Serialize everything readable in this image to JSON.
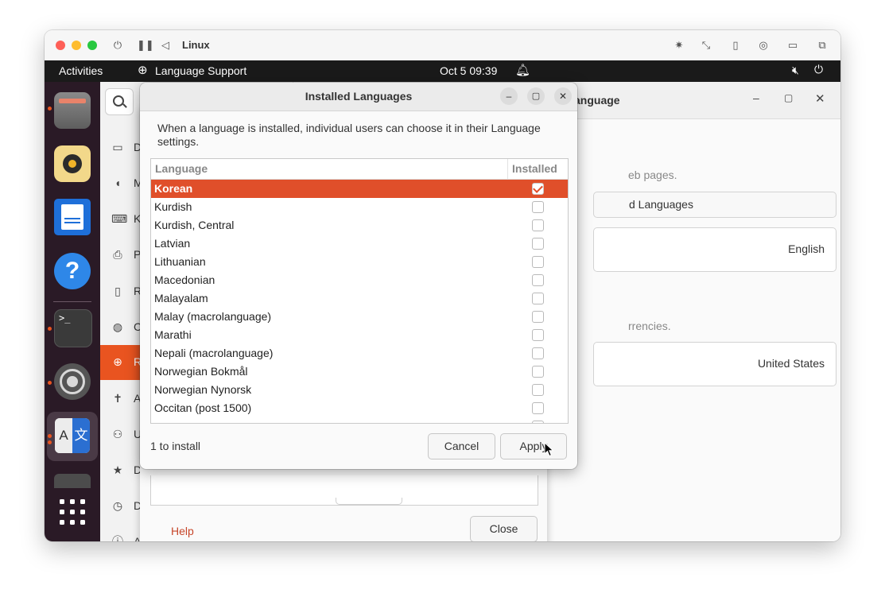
{
  "host": {
    "window_title": "Linux"
  },
  "topbar": {
    "activities": "Activities",
    "app_name": "Language Support",
    "clock": "Oct 5  09:39"
  },
  "settings": {
    "sidebar_letters": [
      "D",
      "M",
      "K",
      "P",
      "R",
      "C",
      "R",
      "A",
      "U",
      "D",
      "D",
      "About"
    ],
    "panel_title_fragment": "anguage",
    "web_pages_fragment": "eb pages.",
    "manage_languages_fragment": "d Languages",
    "language_value": "English",
    "currencies_fragment": "rrencies.",
    "region_value": "United States"
  },
  "language_support": {
    "help_label": "Help",
    "close_label": "Close"
  },
  "dialog": {
    "title": "Installed Languages",
    "description": "When a language is installed, individual users can choose it in their Language settings.",
    "col_language": "Language",
    "col_installed": "Installed",
    "rows": [
      {
        "label": "Korean",
        "installed": true,
        "selected": true
      },
      {
        "label": "Kurdish",
        "installed": false
      },
      {
        "label": "Kurdish, Central",
        "installed": false
      },
      {
        "label": "Latvian",
        "installed": false
      },
      {
        "label": "Lithuanian",
        "installed": false
      },
      {
        "label": "Macedonian",
        "installed": false
      },
      {
        "label": "Malayalam",
        "installed": false
      },
      {
        "label": "Malay (macrolanguage)",
        "installed": false
      },
      {
        "label": "Marathi",
        "installed": false
      },
      {
        "label": "Nepali (macrolanguage)",
        "installed": false
      },
      {
        "label": "Norwegian Bokmål",
        "installed": false
      },
      {
        "label": "Norwegian Nynorsk",
        "installed": false
      },
      {
        "label": "Occitan (post 1500)",
        "installed": false
      }
    ],
    "status": "1 to install",
    "cancel_label": "Cancel",
    "apply_label": "Apply"
  },
  "colors": {
    "accent": "#e95420",
    "selection": "#e04f2a",
    "topbar": "#1a1a1a",
    "dock": "#2a1a26"
  }
}
